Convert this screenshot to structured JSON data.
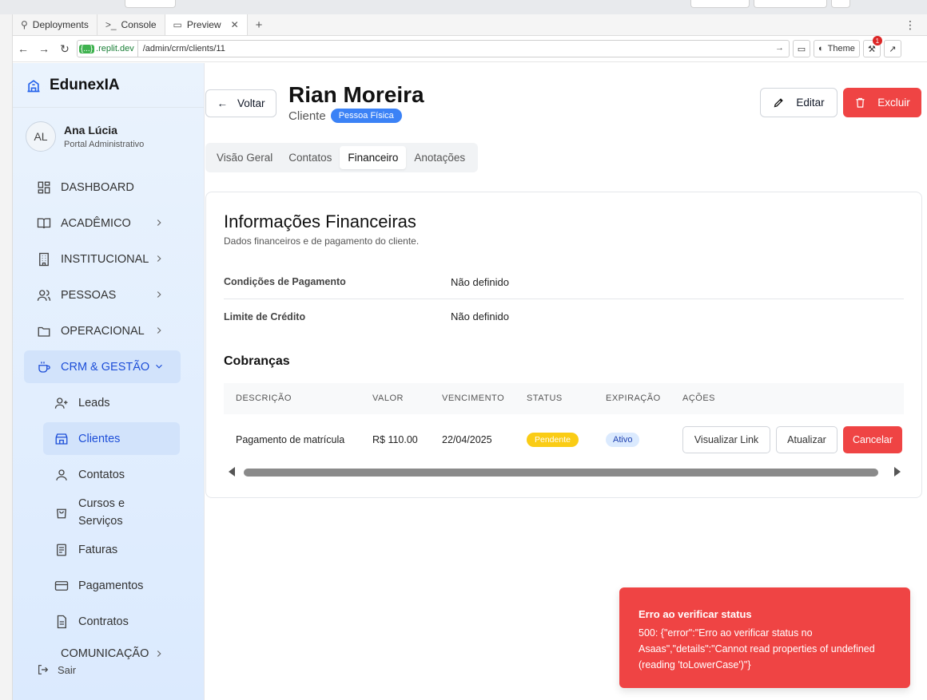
{
  "browser": {
    "tabs": [
      {
        "label": "Deployments",
        "icon": "deployments-icon"
      },
      {
        "label": "Console",
        "icon": "console-icon"
      },
      {
        "label": "Preview",
        "icon": "preview-icon"
      }
    ],
    "add_tab": "+",
    "menu": "⋮",
    "host_badge": "{...}",
    "host": ".replit.dev",
    "path": "/admin/crm/clients/11",
    "theme_label": "Theme",
    "notif_count": "1"
  },
  "sidebar": {
    "brand": "EdunexIA",
    "user_initials": "AL",
    "user_name": "Ana Lúcia",
    "user_role": "Portal Administrativo",
    "items": [
      {
        "label": "DASHBOARD"
      },
      {
        "label": "ACADÊMICO"
      },
      {
        "label": "INSTITUCIONAL"
      },
      {
        "label": "PESSOAS"
      },
      {
        "label": "OPERACIONAL"
      },
      {
        "label": "CRM & GESTÃO"
      }
    ],
    "sub_items": [
      {
        "label": "Leads"
      },
      {
        "label": "Clientes"
      },
      {
        "label": "Contatos"
      },
      {
        "label": "Cursos e Serviços"
      },
      {
        "label": "Faturas"
      },
      {
        "label": "Pagamentos"
      },
      {
        "label": "Contratos"
      }
    ],
    "bottom_item": "COMUNICAÇÃO",
    "logout": "Sair"
  },
  "header": {
    "back_label": "Voltar",
    "title": "Rian Moreira",
    "subtitle": "Cliente",
    "type_badge": "Pessoa Física",
    "edit_label": "Editar",
    "delete_label": "Excluir"
  },
  "tabs": [
    "Visão Geral",
    "Contatos",
    "Financeiro",
    "Anotações"
  ],
  "active_tab": "Financeiro",
  "finance": {
    "title": "Informações Financeiras",
    "subtitle": "Dados financeiros e de pagamento do cliente.",
    "fields": [
      {
        "label": "Condições de Pagamento",
        "value": "Não definido"
      },
      {
        "label": "Limite de Crédito",
        "value": "Não definido"
      }
    ],
    "charges_title": "Cobranças",
    "columns": [
      "DESCRIÇÃO",
      "VALOR",
      "VENCIMENTO",
      "STATUS",
      "EXPIRAÇÃO",
      "AÇÕES"
    ],
    "rows": [
      {
        "description": "Pagamento de matrícula",
        "value": "R$ 110.00",
        "due": "22/04/2025",
        "status": "Pendente",
        "expiration": "Ativo",
        "actions": [
          "Visualizar Link",
          "Atualizar",
          "Cancelar"
        ]
      }
    ]
  },
  "toast": {
    "title": "Erro ao verificar status",
    "message": "500: {\"error\":\"Erro ao verificar status no Asaas\",\"details\":\"Cannot read properties of undefined (reading 'toLowerCase')\"}"
  },
  "colors": {
    "accent": "#3b82f6",
    "danger": "#ef4444",
    "warning": "#facc15",
    "sidebar_active": "#d2e3fb"
  }
}
